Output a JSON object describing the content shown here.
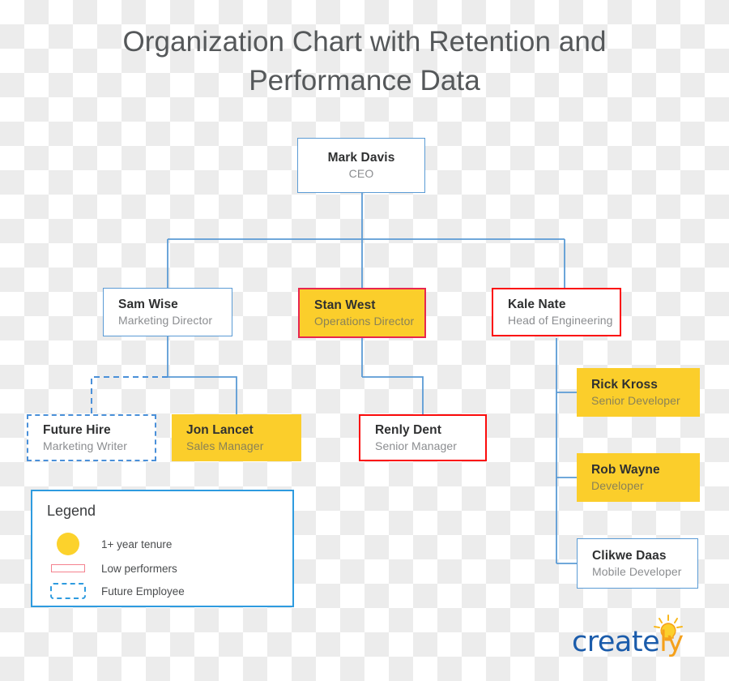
{
  "title": "Organization Chart with Retention and Performance Data",
  "colors": {
    "blue_border": "#5b9bd5",
    "red_border": "#fb0b0b",
    "crimson_border": "#e8264f",
    "gold_fill": "#fbce2b",
    "legend_border": "#2e9bdf",
    "dashed_blue": "#4a90d9",
    "title_text": "#55585a",
    "name_text": "#2f3031",
    "role_text": "#8b8d90",
    "logo_blue": "#1b5cab",
    "logo_orange": "#f5a01b"
  },
  "nodes": [
    {
      "id": "mark-davis",
      "name": "Mark Davis",
      "role": "CEO"
    },
    {
      "id": "sam-wise",
      "name": "Sam Wise",
      "role": "Marketing Director"
    },
    {
      "id": "stan-west",
      "name": "Stan West",
      "role": "Operations Director"
    },
    {
      "id": "kale-nate",
      "name": "Kale Nate",
      "role": "Head of Engineering"
    },
    {
      "id": "future-hire",
      "name": "Future Hire",
      "role": "Marketing Writer"
    },
    {
      "id": "jon-lancet",
      "name": "Jon Lancet",
      "role": "Sales Manager"
    },
    {
      "id": "renly-dent",
      "name": "Renly Dent",
      "role": "Senior Manager"
    },
    {
      "id": "rick-kross",
      "name": "Rick Kross",
      "role": "Senior Developer"
    },
    {
      "id": "rob-wayne",
      "name": "Rob Wayne",
      "role": "Developer"
    },
    {
      "id": "clikwe-daas",
      "name": "Clikwe Daas",
      "role": "Mobile Developer"
    }
  ],
  "legend": {
    "title": "Legend",
    "items": [
      {
        "swatch": "gold-circle",
        "label": "1+ year tenure"
      },
      {
        "swatch": "red-outline",
        "label": "Low performers"
      },
      {
        "swatch": "blue-dashed",
        "label": "Future Employee"
      }
    ]
  },
  "logo": {
    "part1": "create",
    "part2": "ly"
  }
}
